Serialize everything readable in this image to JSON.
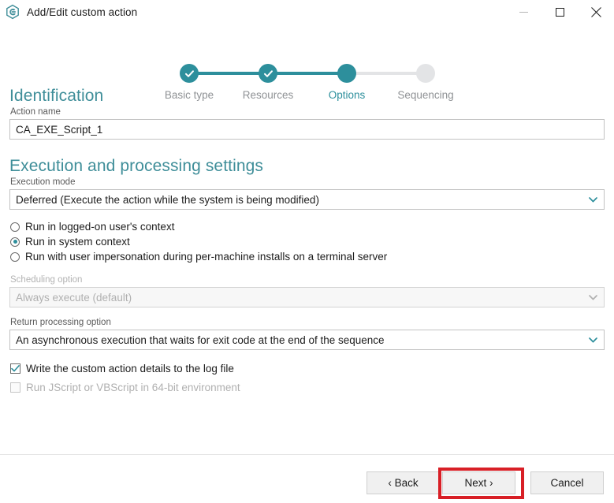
{
  "window": {
    "title": "Add/Edit custom action",
    "app_icon": "hexagon-app-icon",
    "minimize_label": "Minimize",
    "maximize_label": "Maximize",
    "close_label": "Close"
  },
  "theme": {
    "accent": "#2d8f9c",
    "heading": "#3f8e99",
    "inactive_step": "#e3e4e6",
    "highlight": "#d81f26"
  },
  "stepper": {
    "steps": [
      {
        "label": "Basic type",
        "state": "done"
      },
      {
        "label": "Resources",
        "state": "done"
      },
      {
        "label": "Options",
        "state": "active"
      },
      {
        "label": "Sequencing",
        "state": "todo"
      }
    ]
  },
  "sections": {
    "identification": {
      "heading": "Identification",
      "action_name": {
        "label": "Action name",
        "value": "CA_EXE_Script_1",
        "placeholder": "Action name"
      }
    },
    "execution": {
      "heading": "Execution and processing settings",
      "execution_mode": {
        "label": "Execution mode",
        "value": "Deferred (Execute the action while the system is being modified)",
        "chevron": "chevron-down-icon"
      },
      "context_options": [
        {
          "label": "Run in logged-on user's context",
          "selected": false
        },
        {
          "label": "Run in system context",
          "selected": true
        },
        {
          "label": "Run with user impersonation during per-machine installs on a terminal server",
          "selected": false
        }
      ],
      "scheduling_option": {
        "label": "Scheduling option",
        "value": "Always execute (default)",
        "disabled": true,
        "chevron": "chevron-down-icon"
      },
      "return_processing_option": {
        "label": "Return processing option",
        "value": "An asynchronous execution that waits for exit code at the end of the sequence",
        "chevron": "chevron-down-icon"
      },
      "checkboxes": [
        {
          "label": "Write the custom action details to the log file",
          "checked": true,
          "disabled": false
        },
        {
          "label": "Run JScript or VBScript in 64-bit environment",
          "checked": false,
          "disabled": true
        }
      ]
    }
  },
  "footer": {
    "back_label": "‹ Back",
    "next_label": "Next ›",
    "cancel_label": "Cancel"
  }
}
